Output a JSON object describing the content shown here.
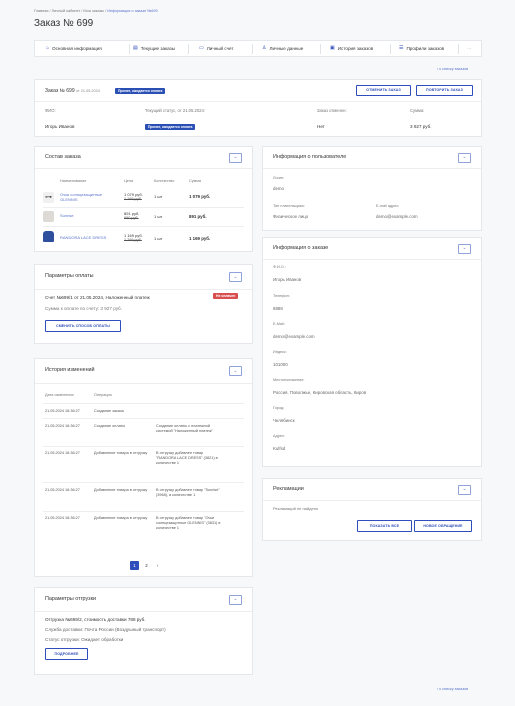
{
  "breadcrumbs": [
    "Главная",
    "Личный кабинет",
    "Мои заказы",
    "Информация о заказе №699"
  ],
  "page_title": "Заказ № 699",
  "tabs": [
    {
      "icon": "home-icon",
      "label": "Основная информация"
    },
    {
      "icon": "cart-icon",
      "label": "Текущие заказы"
    },
    {
      "icon": "wallet-icon",
      "label": "Личный счет"
    },
    {
      "icon": "user-icon",
      "label": "Личные данные"
    },
    {
      "icon": "history-icon",
      "label": "История заказов"
    },
    {
      "icon": "profiles-icon",
      "label": "Профили заказов"
    }
  ],
  "tabs_more": "···",
  "back_link": "к списку заказов",
  "summary": {
    "title": "Заказ № 699",
    "date": "от 21.05.2024",
    "status_badge": "Принят, ожидается оплата",
    "cancel_button": "ОТМЕНИТЬ ЗАКАЗ",
    "repeat_button": "ПОВТОРИТЬ ЗАКАЗ",
    "col_fio": "ФИО:",
    "col_status": "Текущий статус, от 21.05.2024:",
    "col_canceled": "Заказ отменен:",
    "col_sum": "Сумма:",
    "val_fio": "Игорь Иванов",
    "val_status": "Принят, ожидается оплата",
    "val_canceled": "Нет",
    "val_sum": "3 927 руб."
  },
  "composition": {
    "title": "Состав заказа",
    "headers": [
      "Наименование",
      "Цена",
      "Количество",
      "Сумма"
    ],
    "items": [
      {
        "name": "Очки солнцезащитные GLENNIS",
        "price": "1 079 руб.",
        "old_price": "1 199 руб.",
        "qty": "1 шт",
        "sum": "1 079 руб."
      },
      {
        "name": "Sunrise",
        "price": "891 руб.",
        "old_price": "990 руб.",
        "qty": "1 шт",
        "sum": "891 руб."
      },
      {
        "name": "RANDORA LACE DRESS",
        "price": "1 169 руб.",
        "old_price": "1 299 руб.",
        "qty": "1 шт",
        "sum": "1 169 руб."
      }
    ]
  },
  "payment": {
    "title": "Параметры оплаты",
    "line": "Счет №699/1 от 21.05.2024, Наложенный платеж",
    "badge": "Не оплачен",
    "sum_line": "Сумма к оплате по счету: 3 927 руб.",
    "change_button": "СМЕНИТЬ СПОСОБ ОПЛАТЫ"
  },
  "history": {
    "title": "История изменений",
    "headers": [
      "Дата изменения",
      "Операция"
    ],
    "rows": [
      {
        "date": "21.05.2024 16:36:27",
        "op": "Создание заказа",
        "desc": ""
      },
      {
        "date": "21.05.2024 16:36:27",
        "op": "Создание оплаты",
        "desc": "Создание оплаты с платежной системой \"Наложенный платеж\""
      },
      {
        "date": "21.05.2024 16:36:27",
        "op": "Добавление товара в отгрузку",
        "desc": "В отгрузку добавлен товар \"RANDORA LACE DRESS\" (3821) в количестве 1"
      },
      {
        "date": "21.05.2024 16:36:27",
        "op": "Добавление товара в отгрузку",
        "desc": "В отгрузку добавлен товар \"Sunrise\" (3968), в количестве 1"
      },
      {
        "date": "21.05.2024 16:36:27",
        "op": "Добавление товара в отгрузку",
        "desc": "В отгрузку добавлен товар \"Очки солнцезащитные GLENNIS\" (3831) в количестве 1"
      }
    ],
    "pages": [
      "1",
      "2"
    ],
    "next": "›"
  },
  "shipment": {
    "title": "Параметры отгрузки",
    "line1": "Отгрузка №699/2, стоимость доставки 788 руб.",
    "line2": "Служба доставки: Почта России (Воздушный транспорт)",
    "line3": "Статус отгрузки: Ожидает обработки",
    "button": "ПОДРОБНЕЕ"
  },
  "user_info": {
    "title": "Информация о пользователе",
    "login_label": "Логин:",
    "login": "demo",
    "payer_type_label": "Тип плательщика:",
    "payer_type": "Физическое лицо",
    "email_label": "E-mail адрес:",
    "email": "demo@example.com"
  },
  "order_info": {
    "title": "Информация о заказе",
    "fields": [
      {
        "label": "Ф.И.О.:",
        "value": "Игорь Иванов"
      },
      {
        "label": "Телефон:",
        "value": "8888"
      },
      {
        "label": "E-Mail:",
        "value": "demo@example.com"
      },
      {
        "label": "Индекс:",
        "value": "101000"
      },
      {
        "label": "Местоположение:",
        "value": "Россия, Поволжье, Кировская область, Киров"
      },
      {
        "label": "Город:",
        "value": "Челябинск"
      },
      {
        "label": "Адрес:",
        "value": "Kulfsd"
      }
    ]
  },
  "claims": {
    "title": "Рекламации",
    "empty": "Рекламаций не найдено",
    "show_all": "ПОКАЗАТЬ ВСЕ",
    "new_claim": "НОВОЕ ОБРАЩЕНИЕ"
  },
  "colors": {
    "accent": "#2f4dbb",
    "danger": "#d94f4f",
    "link": "#5a74cc"
  }
}
